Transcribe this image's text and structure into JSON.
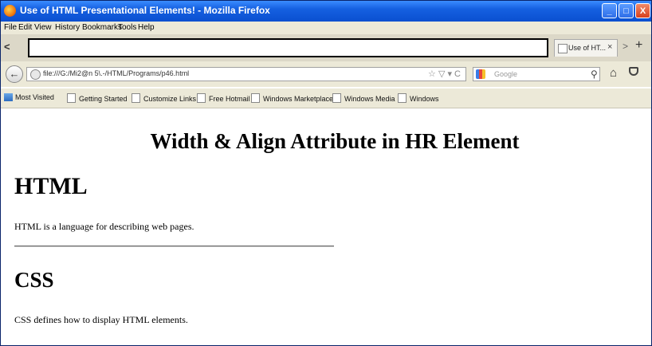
{
  "window": {
    "title": "Use of HTML Presentational Elements! - Mozilla Firefox",
    "controls": {
      "minimize": "_",
      "maximize": "□",
      "close": "X"
    }
  },
  "menu": {
    "items": [
      "File",
      "Edit",
      "View",
      "History",
      "Bookmarks",
      "Tools",
      "Help"
    ]
  },
  "tabs": {
    "left_arrow": "<",
    "active_tab_label": "Use of HT...",
    "close_glyph": "×",
    "scroll_glyph": ">",
    "new_tab_glyph": "+"
  },
  "navbar": {
    "url": "file:///G:/Mi2@n 5\\.-/HTML/Programs/p46.html",
    "search_placeholder": "Google",
    "url_icons": "☆ ▽ ▾ C"
  },
  "bookmarks": {
    "items": [
      "Most Visited",
      "Getting Started",
      "Customize Links",
      "Free Hotmail",
      "Windows Marketplace",
      "Windows Media",
      "Windows"
    ]
  },
  "page": {
    "heading_main": "Width & Align Attribute in HR Element",
    "heading_html": "HTML",
    "para_html": "HTML is a language for describing web pages.",
    "heading_css": "CSS",
    "para_css": "CSS defines how to display HTML elements."
  },
  "icons": {
    "firefox": "firefox-icon",
    "back": "back-arrow-icon",
    "globe": "globe-icon",
    "google": "google-icon",
    "search": "search-icon",
    "home": "home-icon",
    "pocket": "pocket-icon"
  }
}
